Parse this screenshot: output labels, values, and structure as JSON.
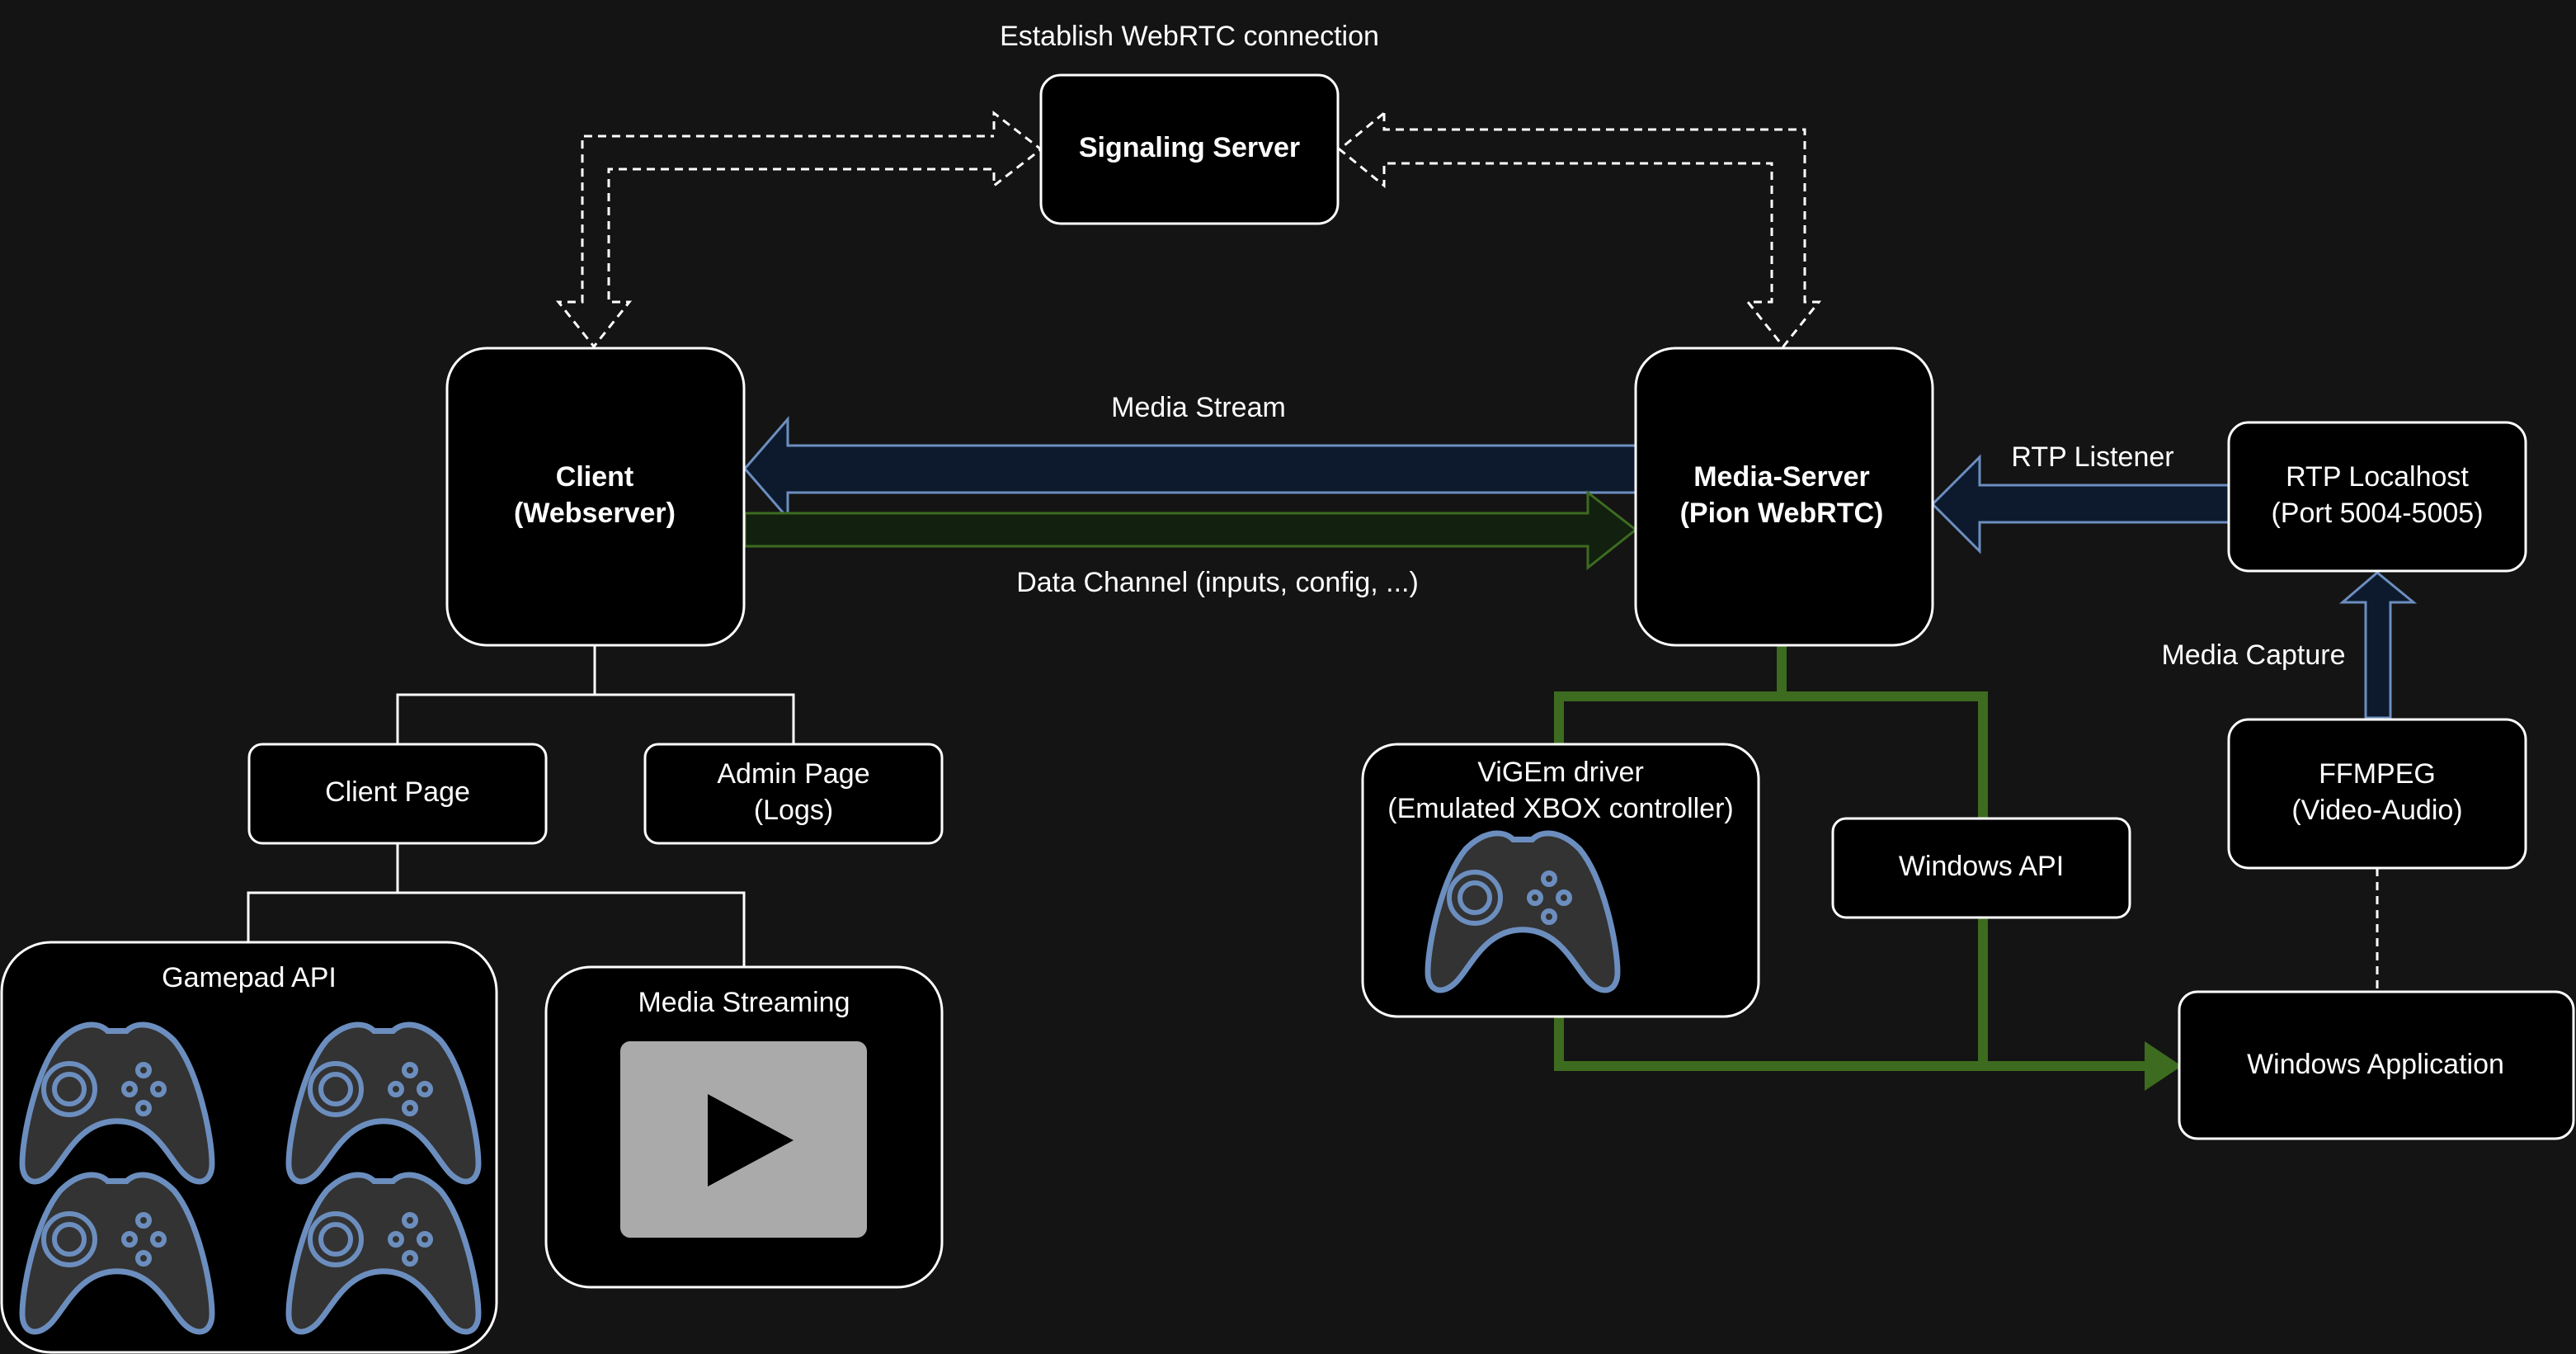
{
  "diagram": {
    "title_label": "Establish WebRTC connection",
    "nodes": {
      "signaling": {
        "line1": "Signaling Server"
      },
      "client": {
        "line1": "Client",
        "line2": "(Webserver)"
      },
      "media_server": {
        "line1": "Media-Server",
        "line2": "(Pion WebRTC)"
      },
      "rtp_localhost": {
        "line1": "RTP Localhost",
        "line2": "(Port 5004-5005)"
      },
      "ffmpeg": {
        "line1": "FFMPEG",
        "line2": "(Video-Audio)"
      },
      "client_page": {
        "line1": "Client Page"
      },
      "admin_page": {
        "line1": "Admin Page",
        "line2": "(Logs)"
      },
      "gamepad_api": {
        "line1": "Gamepad API"
      },
      "media_streaming": {
        "line1": "Media Streaming"
      },
      "vigem": {
        "line1": "ViGEm driver",
        "line2": "(Emulated XBOX controller)"
      },
      "windows_api": {
        "line1": "Windows API"
      },
      "windows_app": {
        "line1": "Windows Application"
      }
    },
    "edges": {
      "media_stream": "Media Stream",
      "data_channel": "Data Channel (inputs, config, ...)",
      "rtp_listener": "RTP Listener",
      "media_capture": "Media Capture"
    },
    "icons": {
      "gamepad": "gamepad-icon",
      "play": "play-icon"
    },
    "colors": {
      "background": "#141414",
      "blue_stroke": "#6c8ebf",
      "blue_fill": "#0d1a2e",
      "green": "#3d6b1f",
      "green_fill": "#12200f"
    }
  }
}
